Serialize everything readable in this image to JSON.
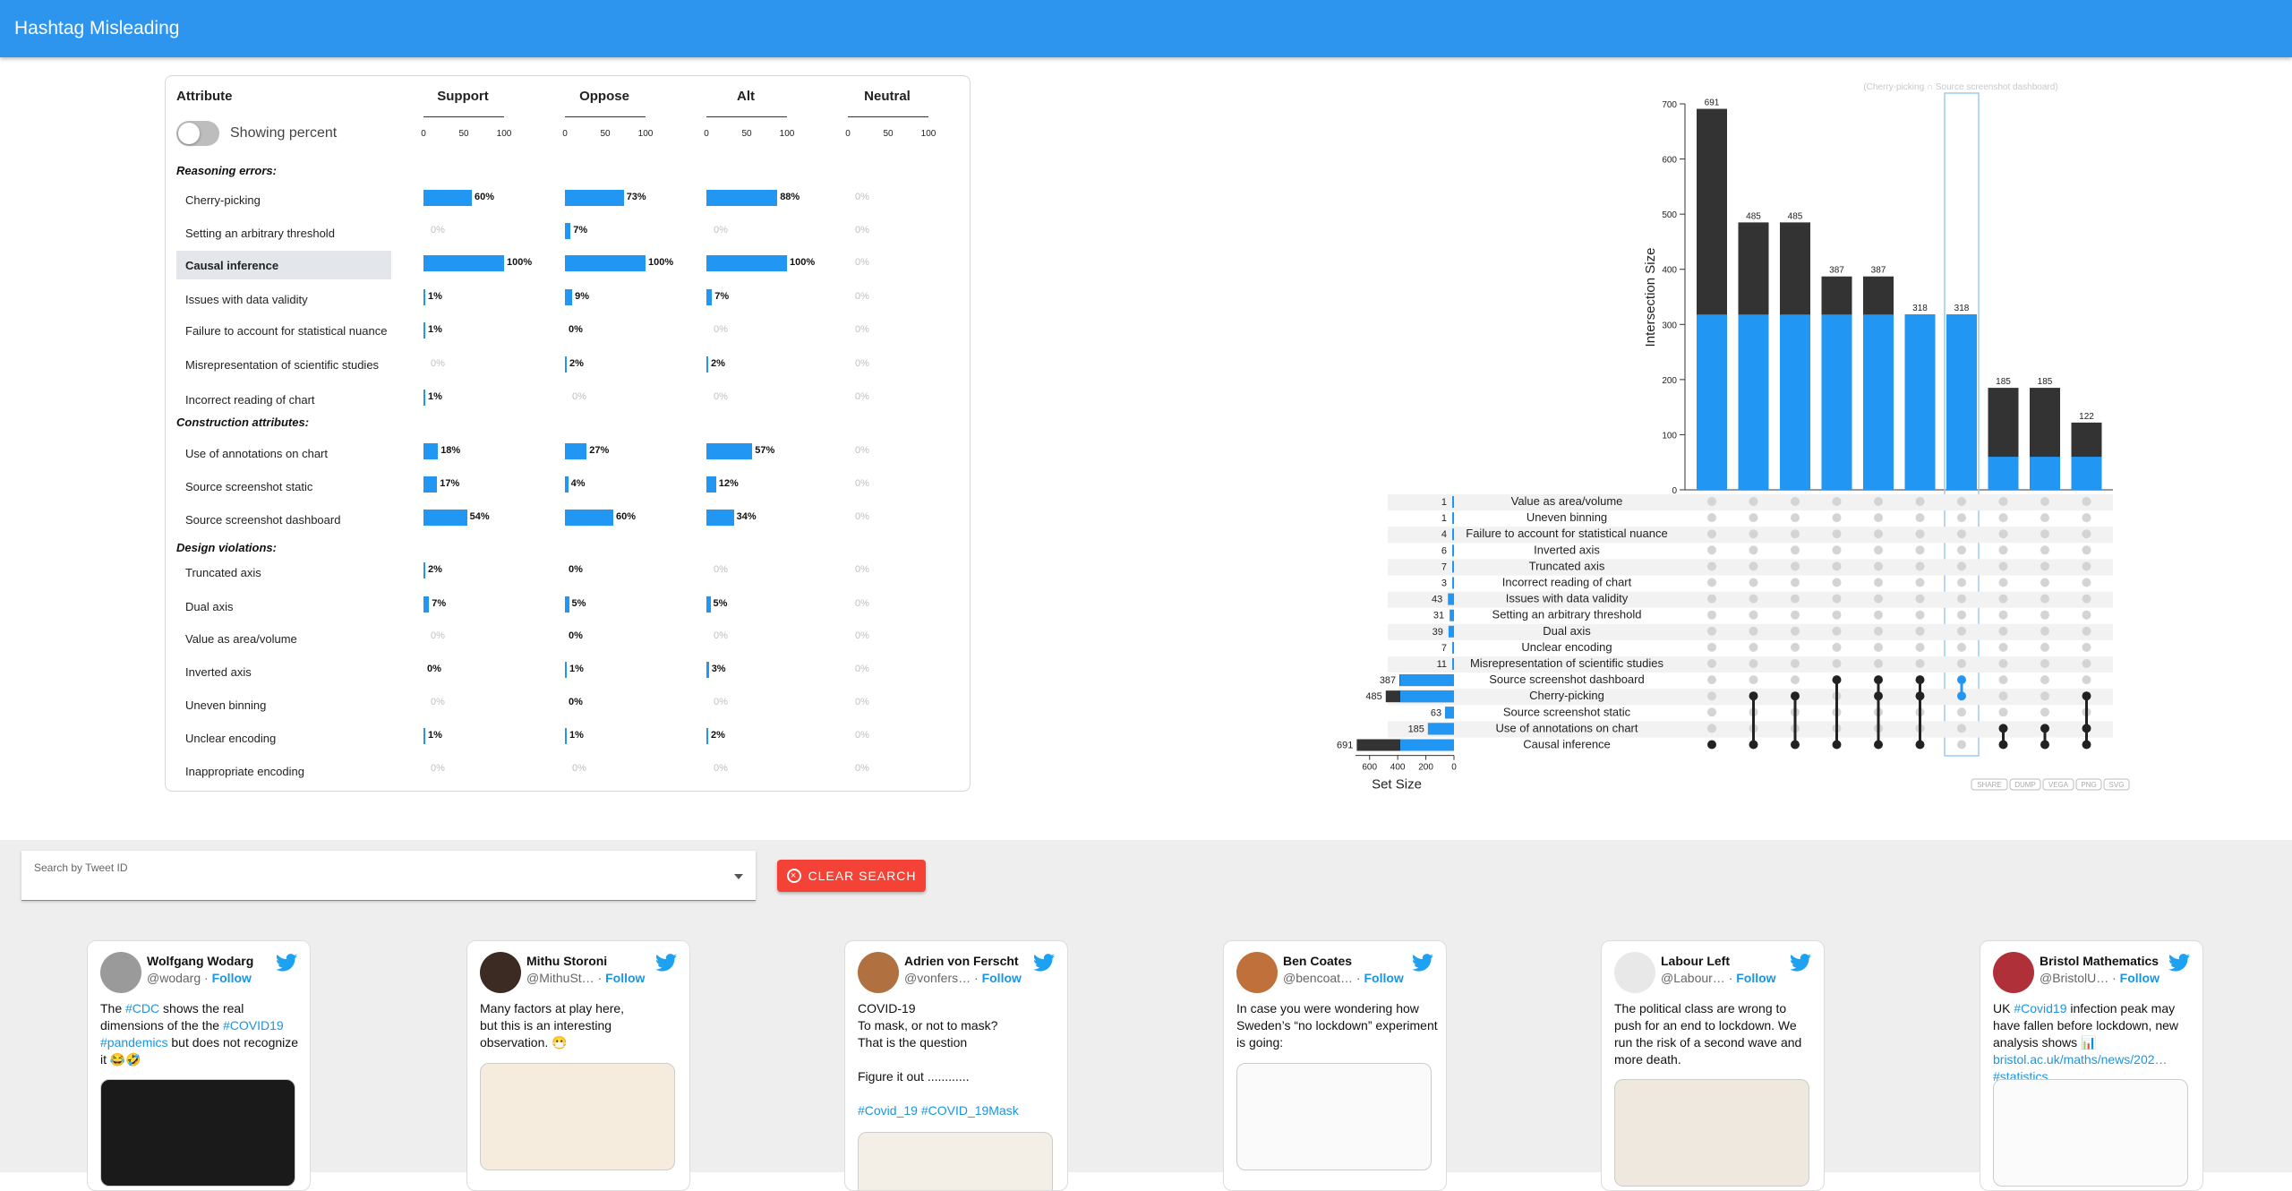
{
  "app": {
    "title": "Hashtag Misleading"
  },
  "table": {
    "attribute_header": "Attribute",
    "toggle_label": "Showing percent",
    "columns": [
      "Support",
      "Oppose",
      "Alt",
      "Neutral"
    ],
    "axis_ticks": [
      "0",
      "50",
      "100"
    ],
    "groups": [
      {
        "label": "Reasoning errors:",
        "rows": [
          {
            "label": "Cherry-picking",
            "values": [
              "60%",
              "73%",
              "88%",
              "0%"
            ],
            "pct": [
              60,
              73,
              88,
              0
            ]
          },
          {
            "label": "Setting an arbitrary threshold",
            "values": [
              "0%",
              "7%",
              "0%",
              "0%"
            ],
            "pct": [
              0,
              7,
              0,
              0
            ]
          },
          {
            "label": "Causal inference",
            "values": [
              "100%",
              "100%",
              "100%",
              "0%"
            ],
            "pct": [
              100,
              100,
              100,
              0
            ],
            "highlighted": true
          },
          {
            "label": "Issues with data validity",
            "values": [
              "1%",
              "9%",
              "7%",
              "0%"
            ],
            "pct": [
              1,
              9,
              7,
              0
            ]
          },
          {
            "label": "Failure to account for statistical nuance",
            "values": [
              "1%",
              "0%",
              "0%",
              "0%"
            ],
            "pct": [
              1,
              0,
              0,
              0
            ]
          },
          {
            "label": "Misrepresentation of scientific studies",
            "values": [
              "0%",
              "2%",
              "2%",
              "0%"
            ],
            "pct": [
              0,
              2,
              2,
              0
            ]
          },
          {
            "label": "Incorrect reading of chart",
            "values": [
              "1%",
              "0%",
              "0%",
              "0%"
            ],
            "pct": [
              1,
              0,
              0,
              0
            ]
          }
        ]
      },
      {
        "label": "Construction attributes:",
        "rows": [
          {
            "label": "Use of annotations on chart",
            "values": [
              "18%",
              "27%",
              "57%",
              "0%"
            ],
            "pct": [
              18,
              27,
              57,
              0
            ]
          },
          {
            "label": "Source screenshot static",
            "values": [
              "17%",
              "4%",
              "12%",
              "0%"
            ],
            "pct": [
              17,
              4,
              12,
              0
            ]
          },
          {
            "label": "Source screenshot dashboard",
            "values": [
              "54%",
              "60%",
              "34%",
              "0%"
            ],
            "pct": [
              54,
              60,
              34,
              0
            ]
          }
        ]
      },
      {
        "label": "Design violations:",
        "rows": [
          {
            "label": "Truncated axis",
            "values": [
              "2%",
              "0%",
              "0%",
              "0%"
            ],
            "pct": [
              2,
              0,
              0,
              0
            ]
          },
          {
            "label": "Dual axis",
            "values": [
              "7%",
              "5%",
              "5%",
              "0%"
            ],
            "pct": [
              7,
              5,
              5,
              0
            ]
          },
          {
            "label": "Value as area/volume",
            "values": [
              "0%",
              "0%",
              "0%",
              "0%"
            ],
            "pct": [
              0,
              0,
              0,
              0
            ]
          },
          {
            "label": "Inverted axis",
            "values": [
              "0%",
              "1%",
              "3%",
              "0%"
            ],
            "pct": [
              0,
              1,
              3,
              0
            ]
          },
          {
            "label": "Uneven binning",
            "values": [
              "0%",
              "0%",
              "0%",
              "0%"
            ],
            "pct": [
              0,
              0,
              0,
              0
            ]
          },
          {
            "label": "Unclear encoding",
            "values": [
              "1%",
              "1%",
              "2%",
              "0%"
            ],
            "pct": [
              1,
              1,
              2,
              0
            ]
          },
          {
            "label": "Inappropriate encoding",
            "values": [
              "0%",
              "0%",
              "0%",
              "0%"
            ],
            "pct": [
              0,
              0,
              0,
              0
            ]
          }
        ]
      }
    ]
  },
  "chart_data": {
    "type": "bar",
    "title": "(Cherry-picking ∩ Source screenshot dashboard)",
    "ylabel": "Intersection Size",
    "xlabel": "Set Size",
    "ylim": [
      0,
      700
    ],
    "yticks": [
      "0",
      "100",
      "200",
      "300",
      "400",
      "500",
      "600",
      "700"
    ],
    "intersection_sizes": [
      691,
      485,
      485,
      387,
      387,
      318,
      318,
      185,
      185,
      122
    ],
    "highlight_overlap": [
      318,
      318,
      318,
      318,
      318,
      318,
      318,
      60,
      60,
      60
    ],
    "selected_column": 6,
    "sets": [
      {
        "name": "Value as area/volume",
        "size": 1
      },
      {
        "name": "Uneven binning",
        "size": 1
      },
      {
        "name": "Failure to account for statistical nuance",
        "size": 4
      },
      {
        "name": "Inverted axis",
        "size": 6
      },
      {
        "name": "Truncated axis",
        "size": 7
      },
      {
        "name": "Incorrect reading of chart",
        "size": 3
      },
      {
        "name": "Issues with data validity",
        "size": 43
      },
      {
        "name": "Setting an arbitrary threshold",
        "size": 31
      },
      {
        "name": "Dual axis",
        "size": 39
      },
      {
        "name": "Unclear encoding",
        "size": 7
      },
      {
        "name": "Misrepresentation of scientific studies",
        "size": 11
      },
      {
        "name": "Source screenshot dashboard",
        "size": 387
      },
      {
        "name": "Cherry-picking",
        "size": 485
      },
      {
        "name": "Source screenshot static",
        "size": 63
      },
      {
        "name": "Use of annotations on chart",
        "size": 185
      },
      {
        "name": "Causal inference",
        "size": 691
      }
    ],
    "set_size_labels": [
      "387",
      "485",
      "63",
      "185",
      "691"
    ],
    "set_size_ticks": [
      "600",
      "400",
      "200",
      "0"
    ],
    "membership": [
      [
        15
      ],
      [
        12,
        15
      ],
      [
        12,
        15
      ],
      [
        11,
        15
      ],
      [
        11,
        12,
        15
      ],
      [
        11,
        12,
        15
      ],
      [
        11,
        12
      ],
      [
        14,
        15
      ],
      [
        14,
        15
      ],
      [
        12,
        14,
        15
      ]
    ],
    "export_buttons": [
      "SHARE",
      "DUMP",
      "VEGA",
      "PNG",
      "SVG"
    ]
  },
  "search": {
    "placeholder": "Search by Tweet ID",
    "clear_label": "CLEAR SEARCH"
  },
  "tweets": [
    {
      "name": "Wolfgang Wodarg",
      "handle": "@wodarg",
      "follow": "Follow",
      "text_parts": [
        [
          "The ",
          0
        ],
        [
          "#CDC",
          1
        ],
        [
          " shows the  real dimensions of the the ",
          0
        ],
        [
          "#COVID19",
          1
        ],
        [
          " ",
          0
        ],
        [
          "#pandemics",
          1
        ],
        [
          " but does not recognize it 😂🤣",
          0
        ]
      ],
      "media_top": 154,
      "avatar_color": "#9a9a9a"
    },
    {
      "name": "Mithu Storoni",
      "handle": "@MithuSt…",
      "follow": "Follow",
      "text_parts": [
        [
          "Many factors at play here,\nbut this is an interesting observation. 😷",
          0
        ]
      ],
      "media_top": 136,
      "avatar_color": "#3b2b22"
    },
    {
      "name": "Adrien von Ferscht",
      "handle": "@vonfers…",
      "follow": "Follow",
      "text_parts": [
        [
          "COVID-19\nTo mask, or not to mask?\nThat is the question\n\nFigure it out ............\n\n",
          0
        ],
        [
          "#Covid_19",
          1
        ],
        [
          "  ",
          0
        ],
        [
          "#COVID_19Mask",
          1
        ]
      ],
      "media_top": 213,
      "avatar_color": "#b07040"
    },
    {
      "name": "Ben Coates",
      "handle": "@bencoat…",
      "follow": "Follow",
      "text_parts": [
        [
          "In case you were wondering how Sweden’s “no lockdown” experiment is going:",
          0
        ]
      ],
      "media_top": 136,
      "avatar_color": "#c0703a"
    },
    {
      "name": "Labour Left",
      "handle": "@Labour…",
      "follow": "Follow",
      "text_parts": [
        [
          "The political class are wrong to push for an end to lockdown. We run the risk of a second wave and more death.",
          0
        ]
      ],
      "media_top": 154,
      "avatar_color": "#e8e8e8"
    },
    {
      "name": "Bristol Mathematics",
      "handle": "@BristolU…",
      "follow": "Follow",
      "text_parts": [
        [
          "UK ",
          0
        ],
        [
          "#Covid19",
          1
        ],
        [
          " infection peak may have fallen before lockdown, new analysis shows 📊 ",
          0
        ],
        [
          "bristol.ac.uk/maths/news/202…",
          1
        ],
        [
          " ",
          0
        ],
        [
          "#statistics",
          1
        ]
      ],
      "media_top": 154,
      "avatar_color": "#b0303a"
    }
  ]
}
